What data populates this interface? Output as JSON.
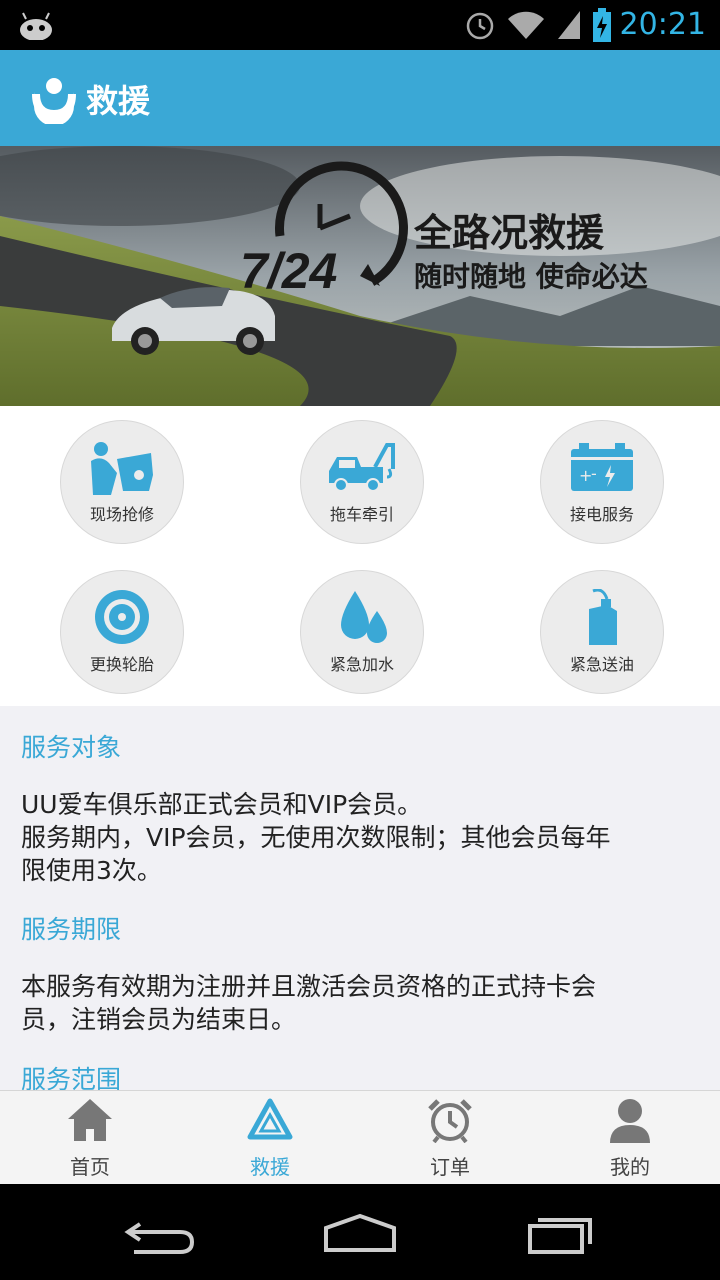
{
  "status_bar": {
    "time": "20:21",
    "icons": [
      "android-icon",
      "alarm-icon",
      "wifi-icon",
      "signal-icon",
      "battery-charging-icon"
    ],
    "accent_color": "#33b5e5"
  },
  "app_bar": {
    "title": "救援",
    "color": "#3aa8d6"
  },
  "banner": {
    "clock_text": "7/24",
    "headline": "全路况救援",
    "tagline": "随时随地 使命必达"
  },
  "services": [
    {
      "label": "现场抢修",
      "icon": "mechanic-repair-icon"
    },
    {
      "label": "拖车牵引",
      "icon": "tow-truck-icon"
    },
    {
      "label": "接电服务",
      "icon": "battery-icon"
    },
    {
      "label": "更换轮胎",
      "icon": "tire-icon"
    },
    {
      "label": "紧急加水",
      "icon": "water-drops-icon"
    },
    {
      "label": "紧急送油",
      "icon": "fuel-can-icon"
    }
  ],
  "sections": [
    {
      "title": "服务对象",
      "body": [
        "UU爱车俱乐部正式会员和VIP会员。",
        "服务期内，VIP会员，无使用次数限制；其他会员每年",
        "限使用3次。"
      ]
    },
    {
      "title": "服务期限",
      "body": [
        "本服务有效期为注册并且激活会员资格的正式持卡会",
        "员，注销会员为结束日。"
      ]
    },
    {
      "title": "服务范围",
      "body": []
    }
  ],
  "bottom_nav": [
    {
      "label": "首页",
      "icon": "home-icon",
      "active": false
    },
    {
      "label": "救援",
      "icon": "rescue-triangle-icon",
      "active": true
    },
    {
      "label": "订单",
      "icon": "alarm-clock-icon",
      "active": false
    },
    {
      "label": "我的",
      "icon": "person-icon",
      "active": false
    }
  ],
  "system_nav": [
    "back-icon",
    "home-outline-icon",
    "recents-icon"
  ]
}
